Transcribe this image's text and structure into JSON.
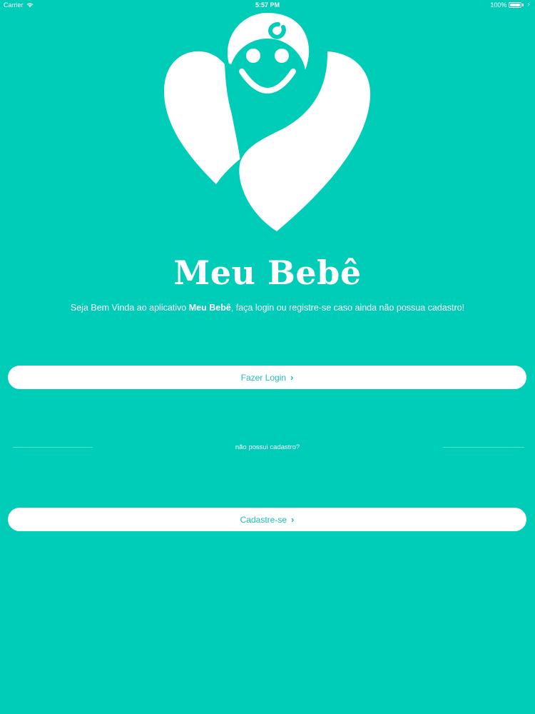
{
  "status_bar": {
    "carrier": "Carrier",
    "time": "5:57 PM",
    "battery": "100%",
    "battery_level": 1.0,
    "icons": [
      "wifi-icon",
      "battery-icon",
      "charging-icon"
    ]
  },
  "logo": {
    "icon": "baby-heart-logo"
  },
  "app": {
    "title": "Meu Bebê"
  },
  "welcome": {
    "prefix": "Seja Bem Vinda ao aplicativo ",
    "app_name": "Meu Bebê",
    "suffix": ", faça login ou registre-se caso ainda não possua cadastro!"
  },
  "buttons": {
    "login_label": "Fazer Login",
    "signup_label": "Cadastre-se",
    "chevron": "›"
  },
  "divider": {
    "text": "não possui cadastro?"
  },
  "colors": {
    "background": "#00cdb7",
    "button_background": "#ffffff",
    "button_text": "#1fc0ae",
    "foreground": "#ffffff"
  }
}
